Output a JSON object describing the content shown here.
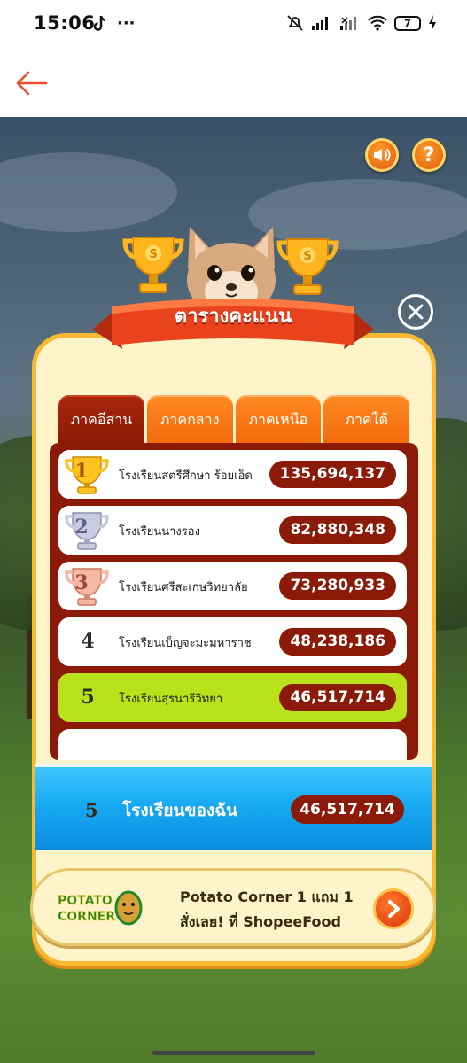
{
  "status_bar": {
    "time": "15:06",
    "battery": "7"
  },
  "header": {
    "back_icon": "arrow-left-icon"
  },
  "game": {
    "sound_icon": "speaker-icon",
    "help_glyph": "?",
    "close_icon": "close-icon",
    "title": "ตารางคะแนน",
    "tabs": [
      {
        "label": "ภาคอีสาน",
        "active": true
      },
      {
        "label": "ภาคกลาง",
        "active": false
      },
      {
        "label": "ภาคเหนือ",
        "active": false
      },
      {
        "label": "ภาคใต้",
        "active": false
      }
    ],
    "leaderboard": [
      {
        "rank": "1",
        "name": "โรงเรียนสตรีศึกษา ร้อยเอ็ด",
        "score": "135,694,137",
        "medal": "gold"
      },
      {
        "rank": "2",
        "name": "โรงเรียนนางรอง",
        "score": "82,880,348",
        "medal": "silver"
      },
      {
        "rank": "3",
        "name": "โรงเรียนศรีสะเกษวิทยาลัย",
        "score": "73,280,933",
        "medal": "bronze"
      },
      {
        "rank": "4",
        "name": "โรงเรียนเบ็ญจะมะมหาราช",
        "score": "48,238,186",
        "medal": "none"
      },
      {
        "rank": "5",
        "name": "โรงเรียนสุรนารีวิทยา",
        "score": "46,517,714",
        "medal": "none",
        "highlight": true
      }
    ],
    "my_school": {
      "rank": "5",
      "name": "โรงเรียนของฉัน",
      "score": "46,517,714"
    },
    "ad": {
      "brand_logo_text": "POTATO CORNER",
      "line1": "Potato Corner 1 แถม 1",
      "line2": "สั่งเลย! ที่ ShopeeFood"
    }
  },
  "colors": {
    "accent_orange": "#f26a0c",
    "dark_red": "#8b1a08",
    "highlight_green": "#b9e21c",
    "my_bar_blue": "#17a9f2"
  }
}
